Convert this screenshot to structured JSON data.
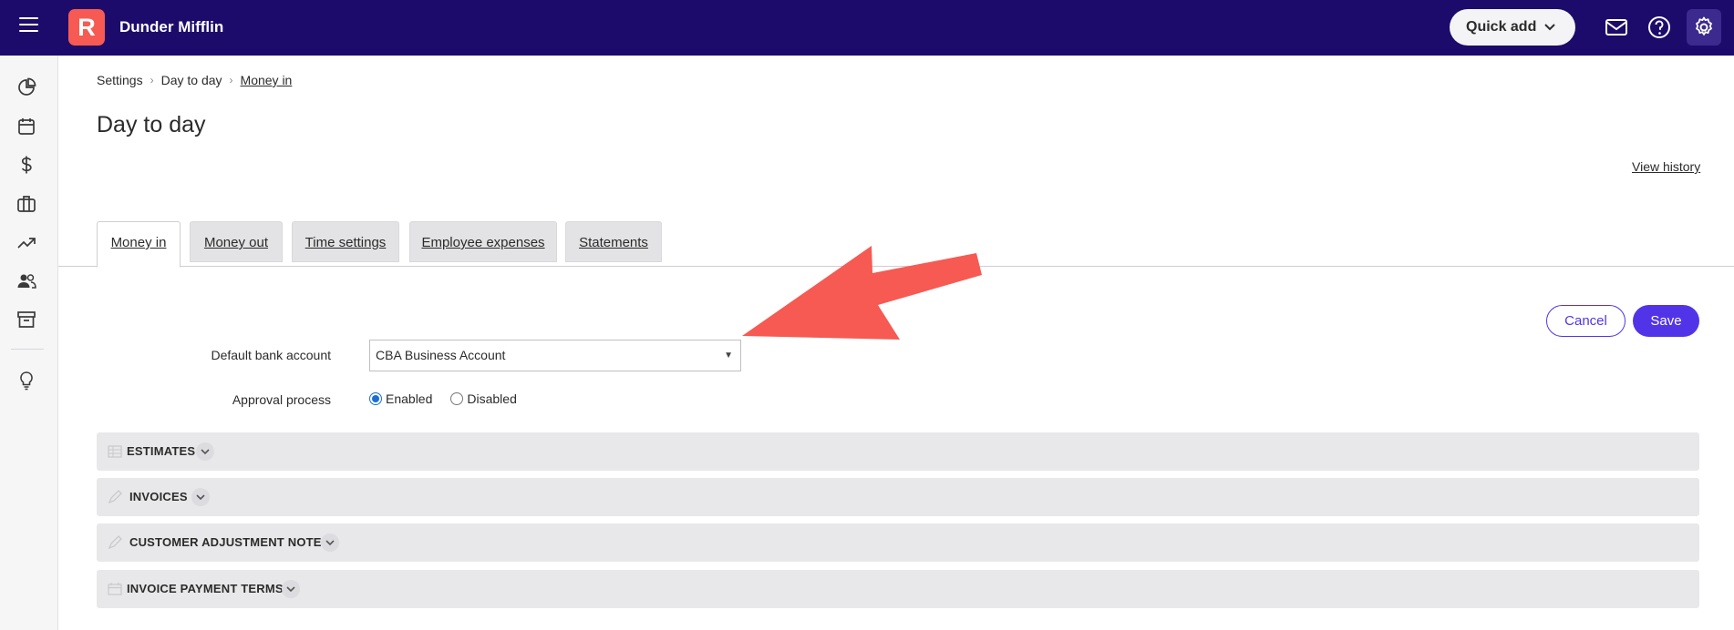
{
  "header": {
    "logo_letter": "R",
    "company_name": "Dunder Mifflin",
    "quick_add_label": "Quick add",
    "bg_color": "#1c0b6b",
    "accent_color": "#f65a52"
  },
  "sidebar": {
    "items": [
      {
        "icon": "dashboard-pie-icon"
      },
      {
        "icon": "calendar-icon"
      },
      {
        "icon": "dollar-icon"
      },
      {
        "icon": "briefcase-icon"
      },
      {
        "icon": "trend-chart-icon"
      },
      {
        "icon": "contacts-icon"
      },
      {
        "icon": "archive-icon"
      },
      {
        "icon": "lightbulb-icon"
      }
    ]
  },
  "breadcrumb": {
    "items": [
      "Settings",
      "Day to day",
      "Money in"
    ]
  },
  "page": {
    "title": "Day to day",
    "view_history": "View history"
  },
  "tabs": [
    {
      "label": "Money in",
      "active": true
    },
    {
      "label": "Money out",
      "active": false
    },
    {
      "label": "Time settings",
      "active": false
    },
    {
      "label": "Employee expenses",
      "active": false
    },
    {
      "label": "Statements",
      "active": false
    }
  ],
  "form": {
    "cancel_label": "Cancel",
    "save_label": "Save",
    "bank_account_label": "Default bank account",
    "bank_account_value": "CBA Business Account",
    "approval_label": "Approval process",
    "approval_options": [
      "Enabled",
      "Disabled"
    ],
    "approval_selected": "Enabled",
    "primary_color": "#5234e8"
  },
  "sections": [
    {
      "title": "ESTIMATES",
      "icon": "estimates-icon"
    },
    {
      "title": "INVOICES",
      "icon": "invoice-pen-icon"
    },
    {
      "title": "CUSTOMER ADJUSTMENT NOTES",
      "icon": "adjustment-pen-icon"
    },
    {
      "title": "INVOICE PAYMENT TERMS",
      "icon": "calendar-icon"
    }
  ],
  "annotation": {
    "color": "#f65a52"
  }
}
